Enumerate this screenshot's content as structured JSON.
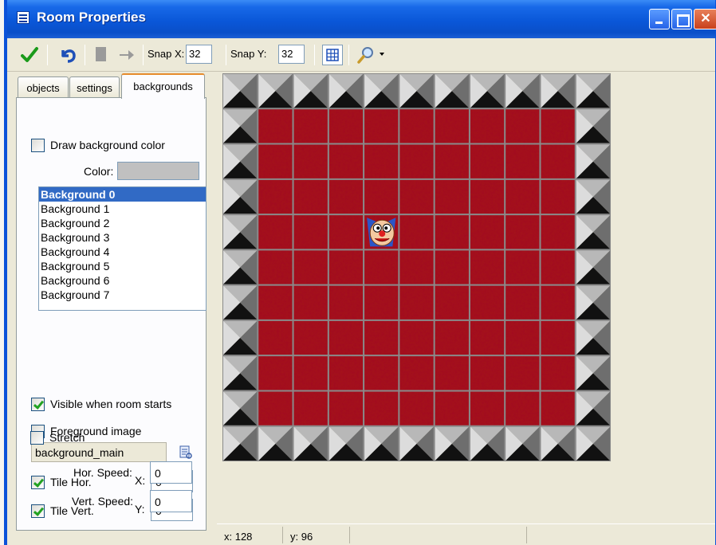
{
  "window": {
    "title": "Room Properties"
  },
  "toolbar": {
    "snap_x_label": "Snap X:",
    "snap_x_value": "32",
    "snap_y_label": "Snap Y:",
    "snap_y_value": "32"
  },
  "tabs": [
    {
      "label": "objects"
    },
    {
      "label": "settings"
    },
    {
      "label": "backgrounds",
      "active": true
    }
  ],
  "backgrounds": {
    "draw_bg_color_label": "Draw background color",
    "draw_bg_color_checked": false,
    "color_label": "Color:",
    "color_value": "#c0c0c0",
    "list": [
      "Background 0",
      "Background 1",
      "Background 2",
      "Background 3",
      "Background 4",
      "Background 5",
      "Background 6",
      "Background 7"
    ],
    "selected_index": 0,
    "visible_label": "Visible when room starts",
    "visible_checked": true,
    "foreground_label": "Foreground image",
    "foreground_checked": false,
    "background_name": "background_main",
    "tile_hor_label": "Tile Hor.",
    "tile_hor_checked": true,
    "x_label": "X:",
    "x_value": "0",
    "tile_vert_label": "Tile Vert.",
    "tile_vert_checked": true,
    "y_label": "Y:",
    "y_value": "0",
    "stretch_label": "Stretch",
    "stretch_checked": false,
    "hor_speed_label": "Hor. Speed:",
    "hor_speed_value": "0",
    "vert_speed_label": "Vert. Speed:",
    "vert_speed_value": "0"
  },
  "room": {
    "columns": 11,
    "rows": 11,
    "floor_color": "#a4141a",
    "grid_color": "#8a8a8a",
    "sprite": "clown-face",
    "sprite_cell": {
      "col": 4,
      "row": 4
    }
  },
  "status": {
    "x": "x: 128",
    "y": "y: 96"
  }
}
